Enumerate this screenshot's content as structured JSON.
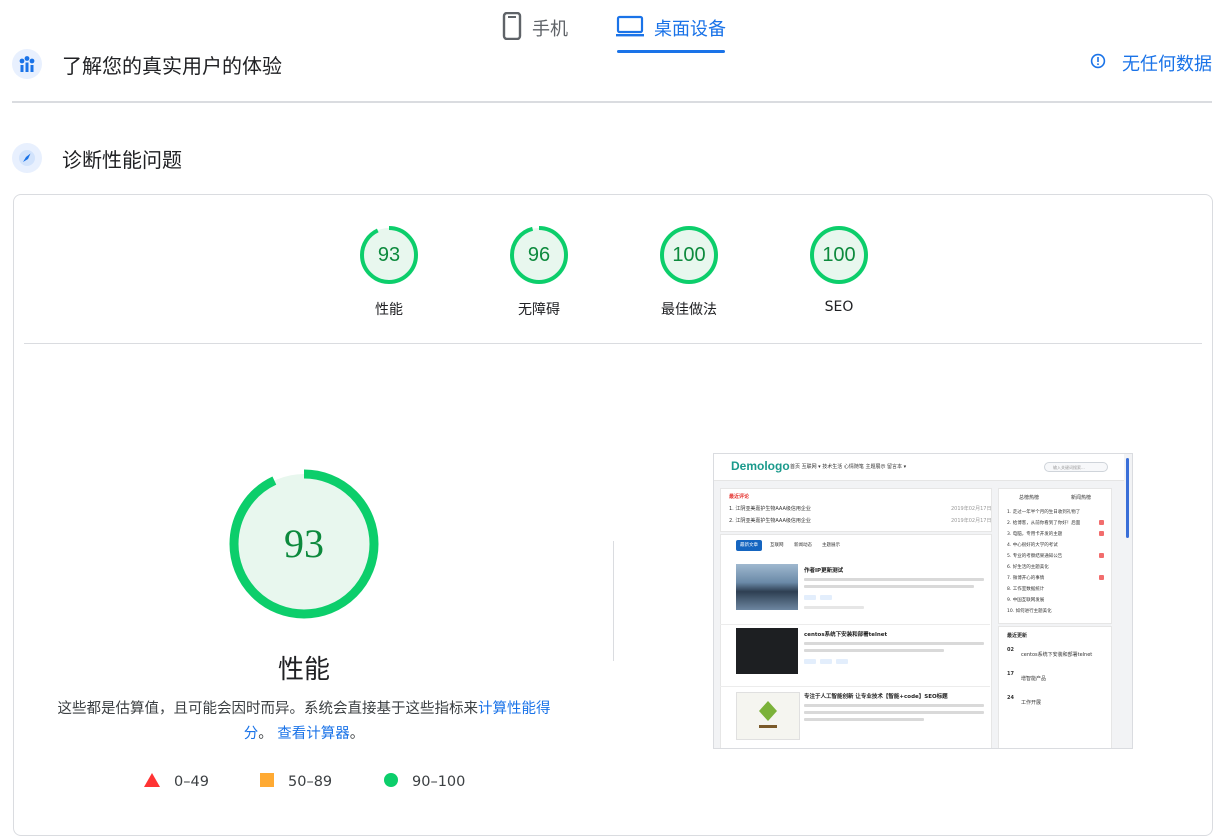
{
  "tabs": [
    {
      "label": "手机",
      "icon": "phone-icon",
      "active": false
    },
    {
      "label": "桌面设备",
      "icon": "desktop-icon",
      "active": true
    }
  ],
  "field_section": {
    "title": "了解您的真实用户的体验",
    "icon": "users-chart-icon",
    "no_data_label": "无任何数据",
    "no_data_icon": "info-icon"
  },
  "diagnose_section": {
    "title": "诊断性能问题",
    "icon": "lighthouse-icon"
  },
  "categories": [
    {
      "label": "性能",
      "score": "93",
      "fraction": 0.93
    },
    {
      "label": "无障碍",
      "score": "96",
      "fraction": 0.96
    },
    {
      "label": "最佳做法",
      "score": "100",
      "fraction": 1.0
    },
    {
      "label": "SEO",
      "score": "100",
      "fraction": 1.0
    }
  ],
  "performance": {
    "score": "93",
    "fraction": 0.93,
    "title": "性能",
    "description_prefix": "这些都是估算值，且可能会因时而异。系统会直接基于这些指标来",
    "calc_link": "计算性能得分",
    "separator": "。",
    "calculator_link": "查看计算器",
    "suffix": "。"
  },
  "legend": [
    {
      "shape": "triangle",
      "range": "0–49",
      "color": "#ff3333"
    },
    {
      "shape": "square",
      "range": "50–89",
      "color": "#ffaa33"
    },
    {
      "shape": "circle",
      "range": "90–100",
      "color": "#0cce6b"
    }
  ],
  "colors": {
    "accent": "#1a73e8",
    "pass": "#0cce6b",
    "pass_text": "#0d8a3d",
    "pass_fill": "#e8f7ee"
  },
  "thumbnail": {
    "logo": "Demologo",
    "nav": "首页   互联网 ▾   技术生活   心情随笔   主题展示   留言本 ▾",
    "search_placeholder": "输入关键词搜索...",
    "notice_heading": "最近评论",
    "notices": [
      {
        "text": "1. 江阴亚美嘉护生物AAA级信用企业",
        "date": "2019年02月17日"
      },
      {
        "text": "2. 江阴亚美嘉护生物AAA级信用企业",
        "date": "2019年02月17日"
      }
    ],
    "sidebar_tabs": [
      "总榜热榜",
      "新闻热榜"
    ],
    "rank_items": [
      "1. 走过一年半个月的生日收到礼物了",
      "2. 给博客，从前你看到了你好！后面",
      "3. 电脑，专用卡开发的主题",
      "4. 中心很好的大学的考试",
      "5. 专业的考察结果通知公告",
      "6. 好生活的主题美化",
      "7. 微博开心的事情",
      "8. 工作室数据统计",
      "9. 中国互联网发展",
      "10. 如何进行主题美化"
    ],
    "content_tabs": [
      "最新文章",
      "互联网",
      "新闻动态",
      "主题展示"
    ],
    "posts": [
      {
        "title": "作者IP更新测试"
      },
      {
        "title": "centos系统下安装和部署telnet"
      },
      {
        "title": "专注于人工智能创新  让专业技术【智能+code】SEO标题"
      }
    ],
    "recent_heading": "最近更新",
    "recent_items": [
      {
        "day": "02",
        "text": "centos系统下安装和部署telnet"
      },
      {
        "day": "17",
        "text": "增智能产品"
      },
      {
        "day": "24",
        "text": "工作开展"
      }
    ]
  }
}
